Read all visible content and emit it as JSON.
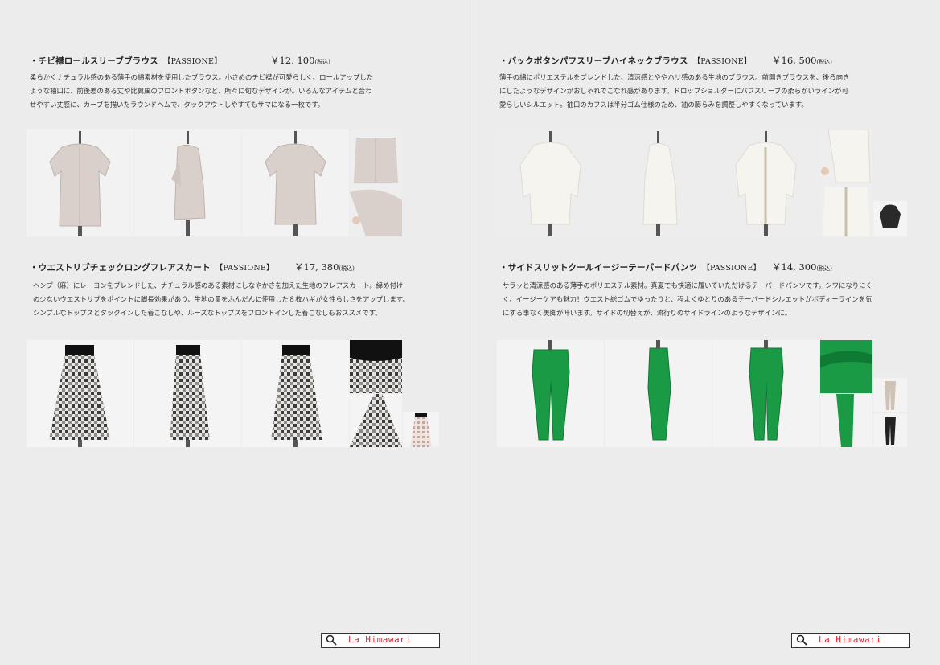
{
  "products": [
    {
      "title": "・チビ襟ロールスリーブブラウス",
      "brand": "【PASSIONE】",
      "price": "￥12, 100",
      "tax": "(税込)",
      "desc": [
        "柔らかくナチュラル感のある薄手の綿素材を使用したブラウス。小さめのチビ襟が可愛らしく、ロールアップした",
        "ような袖口に、前後差のある丈や比翼風のフロントボタンなど、所々に旬なデザインが。いろんなアイテムと合わ",
        "せやすい丈感に、カーブを描いたラウンドヘムで、タックアウトしやすてもサマになる一枚です。"
      ],
      "colors": {
        "item": "#d9cfcb",
        "item_dark": "#bfb3ad",
        "bg": "#f2f2f2"
      }
    },
    {
      "title": "・バックボタンパフスリーブハイネックブラウス",
      "brand": "【PASSIONE】",
      "price": "￥16, 500",
      "tax": "(税込)",
      "desc": [
        "薄手の綿にポリエステルをブレンドした、清涼感とややハリ感のある生地のブラウス。前開きブラウスを、後ろ向き",
        "にしたようなデザインがおしゃれでこなれ感があります。ドロップショルダーにパフスリーブの柔らかいラインが可",
        "愛らしいシルエット。袖口のカフスは半分ゴム仕様のため、袖の膨らみを調整しやすくなっています。"
      ],
      "colors": {
        "item": "#f6f4ee",
        "item_dark": "#dedbd2",
        "bg": "#ededed",
        "alt": "#2a2a2a"
      }
    },
    {
      "title": "・ウエストリブチェックロングフレアスカート",
      "brand": "【PASSIONE】",
      "price": "￥17, 380",
      "tax": "(税込)",
      "desc": [
        "ヘンプ（麻）にレーヨンをブレンドした、ナチュラル感のある素材にしなやかさを加えた生地のフレアスカート。締め付け",
        "の少ないウエストリブをポイントに脚長効果があり、生地の量をふんだんに使用した８枚ハギが女性らしさをアップします。",
        "シンプルなトップスとタックインした着こなしや、ルーズなトップスをフロントインした着こなしもおススメです。"
      ],
      "colors": {
        "item": "#3a3a3a",
        "item_light": "#e8e4df",
        "bg": "#f4f4f4",
        "band": "#111111",
        "alt": "#c9a49a"
      }
    },
    {
      "title": "・サイドスリットクールイージーテーパードパンツ",
      "brand": "【PASSIONE】",
      "price": "￥14, 300",
      "tax": "(税込)",
      "desc": [
        "サラッと清涼感のある薄手のポリエステル素材。真夏でも快適に履いていただけるテーパードパンツです。シワになりにく",
        "く、イージーケアも魅力！ウエスト総ゴムでゆったりと、程よくゆとりのあるテーパードシルエットがボディーラインを気",
        "にする事なく美脚が叶います。サイドの切替えが、流行りのサイドラインのようなデザインに。"
      ],
      "colors": {
        "item": "#1a9a45",
        "item_dark": "#0e7a33",
        "bg": "#f3f3f3",
        "alt1": "#cfc3b5",
        "alt2": "#222222"
      }
    }
  ],
  "footer": {
    "logo_text": "La Himawari",
    "icon": "magnifier-icon",
    "accent": "#e0202a"
  }
}
